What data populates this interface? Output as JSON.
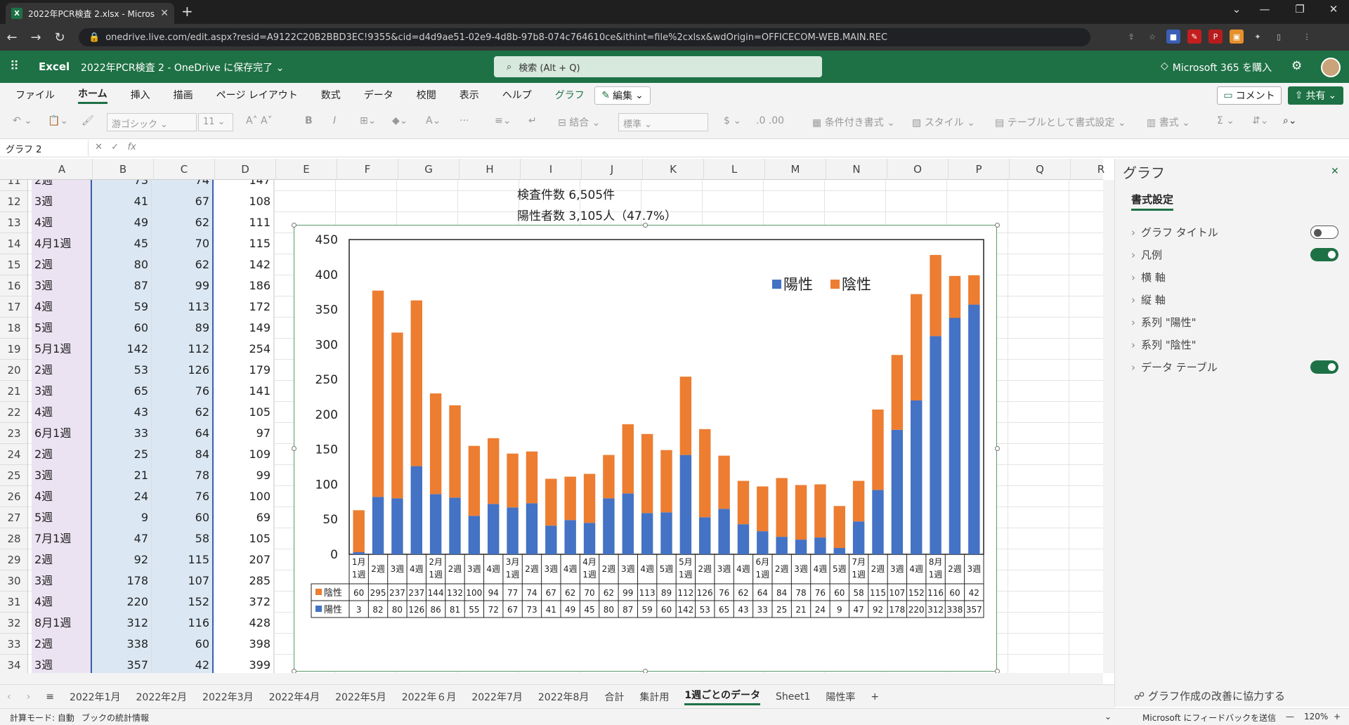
{
  "browser": {
    "tab_title": "2022年PCR検査 2.xlsx - Microsoft",
    "url": "onedrive.live.com/edit.aspx?resid=A9122C20B2BBD3EC!9355&cid=d4d9ae51-02e9-4d8b-97b8-074c764610ce&ithint=file%2cxlsx&wdOrigin=OFFICECOM-WEB.MAIN.REC"
  },
  "excel": {
    "app": "Excel",
    "doc": "2022年PCR検査 2 - OneDrive に保存完了",
    "search_placeholder": "検索 (Alt + Q)",
    "buy": "Microsoft 365 を購入",
    "menu": [
      "ファイル",
      "ホーム",
      "挿入",
      "描画",
      "ページ レイアウト",
      "数式",
      "データ",
      "校閲",
      "表示",
      "ヘルプ",
      "グラフ"
    ],
    "edit": "編集",
    "comment": "コメント",
    "share": "共有",
    "font": "游ゴシック",
    "size": "11",
    "format": "標準",
    "merge": "結合",
    "cond": "条件付き書式",
    "style": "スタイル",
    "table": "テーブルとして書式設定",
    "fmt": "書式",
    "namebox": "グラフ 2"
  },
  "sheet": {
    "columns": [
      "A",
      "B",
      "C",
      "D",
      "E",
      "F",
      "G",
      "H",
      "I",
      "J",
      "K",
      "L",
      "M",
      "N",
      "O",
      "P",
      "Q",
      "R"
    ],
    "rows": [
      {
        "n": "11",
        "a": "2週",
        "b": "73",
        "c": "74",
        "d": "147"
      },
      {
        "n": "12",
        "a": "3週",
        "b": "41",
        "c": "67",
        "d": "108"
      },
      {
        "n": "13",
        "a": "4週",
        "b": "49",
        "c": "62",
        "d": "111"
      },
      {
        "n": "14",
        "a": "4月1週",
        "b": "45",
        "c": "70",
        "d": "115"
      },
      {
        "n": "15",
        "a": "2週",
        "b": "80",
        "c": "62",
        "d": "142"
      },
      {
        "n": "16",
        "a": "3週",
        "b": "87",
        "c": "99",
        "d": "186"
      },
      {
        "n": "17",
        "a": "4週",
        "b": "59",
        "c": "113",
        "d": "172"
      },
      {
        "n": "18",
        "a": "5週",
        "b": "60",
        "c": "89",
        "d": "149"
      },
      {
        "n": "19",
        "a": "5月1週",
        "b": "142",
        "c": "112",
        "d": "254"
      },
      {
        "n": "20",
        "a": "2週",
        "b": "53",
        "c": "126",
        "d": "179"
      },
      {
        "n": "21",
        "a": "3週",
        "b": "65",
        "c": "76",
        "d": "141"
      },
      {
        "n": "22",
        "a": "4週",
        "b": "43",
        "c": "62",
        "d": "105"
      },
      {
        "n": "23",
        "a": "6月1週",
        "b": "33",
        "c": "64",
        "d": "97"
      },
      {
        "n": "24",
        "a": "2週",
        "b": "25",
        "c": "84",
        "d": "109"
      },
      {
        "n": "25",
        "a": "3週",
        "b": "21",
        "c": "78",
        "d": "99"
      },
      {
        "n": "26",
        "a": "4週",
        "b": "24",
        "c": "76",
        "d": "100"
      },
      {
        "n": "27",
        "a": "5週",
        "b": "9",
        "c": "60",
        "d": "69"
      },
      {
        "n": "28",
        "a": "7月1週",
        "b": "47",
        "c": "58",
        "d": "105"
      },
      {
        "n": "29",
        "a": "2週",
        "b": "92",
        "c": "115",
        "d": "207"
      },
      {
        "n": "30",
        "a": "3週",
        "b": "178",
        "c": "107",
        "d": "285"
      },
      {
        "n": "31",
        "a": "4週",
        "b": "220",
        "c": "152",
        "d": "372"
      },
      {
        "n": "32",
        "a": "8月1週",
        "b": "312",
        "c": "116",
        "d": "428"
      },
      {
        "n": "33",
        "a": "2週",
        "b": "338",
        "c": "60",
        "d": "398"
      },
      {
        "n": "34",
        "a": "3週",
        "b": "357",
        "c": "42",
        "d": "399"
      }
    ],
    "info1": "検査件数 6,505件",
    "info2": "陽性者数 3,105人（47.7%）"
  },
  "chart_data": {
    "type": "bar",
    "stacked": true,
    "ylim": [
      0,
      450
    ],
    "yticks": [
      0,
      50,
      100,
      150,
      200,
      250,
      300,
      350,
      400,
      450
    ],
    "categories": [
      "1月1週",
      "2週",
      "3週",
      "4週",
      "2月1週",
      "2週",
      "3週",
      "4週",
      "3月1週",
      "2週",
      "3週",
      "4週",
      "4月1週",
      "2週",
      "3週",
      "4週",
      "5週",
      "5月1週",
      "2週",
      "3週",
      "4週",
      "6月1週",
      "2週",
      "3週",
      "4週",
      "5週",
      "7月1週",
      "2週",
      "3週",
      "4週",
      "8月1週",
      "2週",
      "3週"
    ],
    "series": [
      {
        "name": "陽性",
        "color": "#4472c4",
        "values": [
          3,
          82,
          80,
          126,
          86,
          81,
          55,
          72,
          67,
          73,
          41,
          49,
          45,
          80,
          87,
          59,
          60,
          142,
          53,
          65,
          43,
          33,
          25,
          21,
          24,
          9,
          47,
          92,
          178,
          220,
          312,
          338,
          357
        ]
      },
      {
        "name": "陰性",
        "color": "#ed7d31",
        "values": [
          60,
          295,
          237,
          237,
          144,
          132,
          100,
          94,
          77,
          74,
          67,
          62,
          70,
          62,
          99,
          113,
          89,
          112,
          126,
          76,
          62,
          64,
          84,
          78,
          76,
          60,
          58,
          115,
          107,
          152,
          116,
          60,
          42
        ]
      }
    ],
    "legend": "top-right",
    "data_table": true
  },
  "panel": {
    "title": "グラフ",
    "subtitle": "書式設定",
    "items": [
      {
        "label": "グラフ タイトル",
        "toggle": "off"
      },
      {
        "label": "凡例",
        "toggle": "on"
      },
      {
        "label": "横 軸"
      },
      {
        "label": "縦 軸"
      },
      {
        "label": "系列 \"陽性\""
      },
      {
        "label": "系列 \"陰性\""
      },
      {
        "label": "データ テーブル",
        "toggle": "on"
      }
    ],
    "footer": "グラフ作成の改善に協力する"
  },
  "sheettabs": [
    "2022年1月",
    "2022年2月",
    "2022年3月",
    "2022年4月",
    "2022年5月",
    "2022年６月",
    "2022年7月",
    "2022年8月",
    "合計",
    "集計用",
    "1週ごとのデータ",
    "Sheet1",
    "陽性率"
  ],
  "active_sheet": "1週ごとのデータ",
  "status": {
    "mode": "計算モード: 自動",
    "stats": "ブックの統計情報",
    "feedback": "Microsoft にフィードバックを送信",
    "zoom": "120%"
  }
}
